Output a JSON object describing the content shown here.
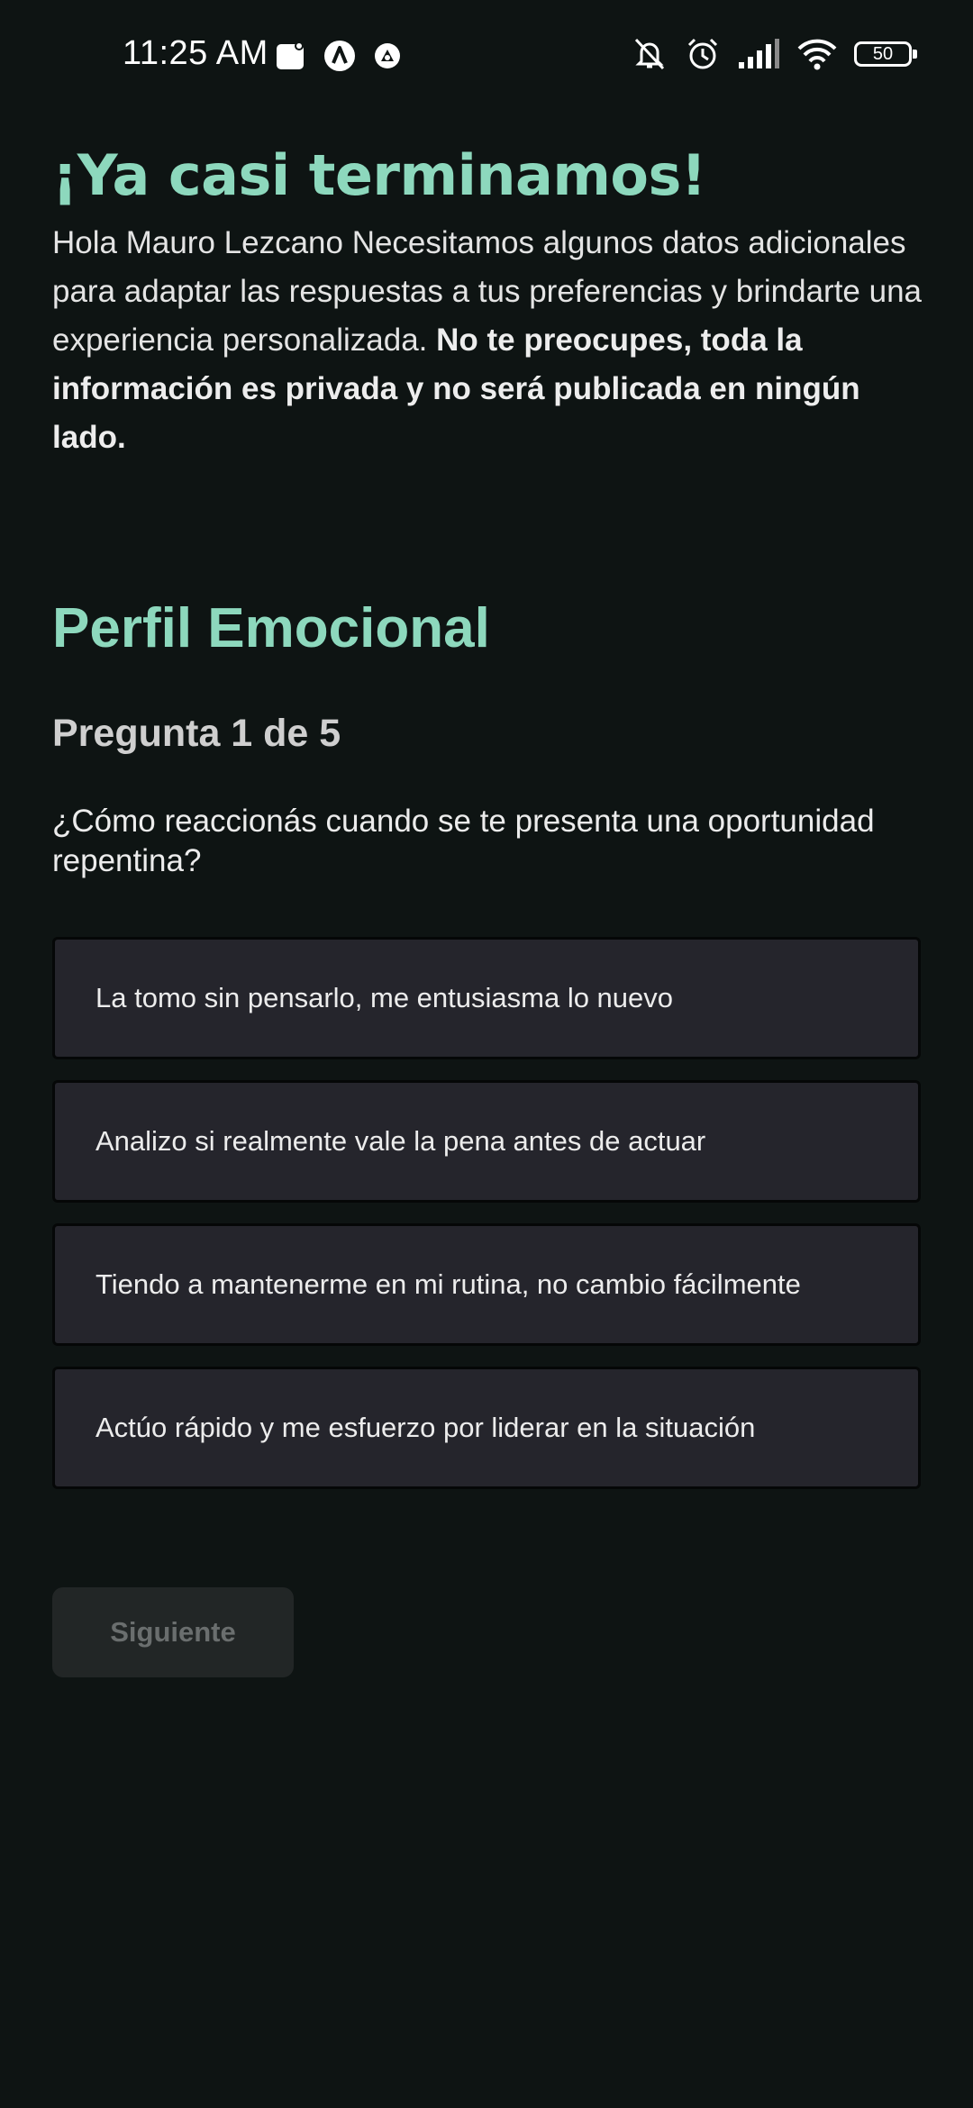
{
  "status_bar": {
    "time": "11:25 AM",
    "battery_level": "50",
    "left_icons": [
      "notification-square-icon",
      "app-a-icon",
      "app-notification-icon"
    ],
    "right_icons": [
      "mute-icon",
      "alarm-icon",
      "signal-icon",
      "wifi-icon",
      "battery-icon"
    ]
  },
  "header": {
    "title": "¡Ya casi terminamos!",
    "intro_text": "Hola Mauro Lezcano Necesitamos algunos datos adicionales para adaptar las respuestas a tus preferencias y brindarte una experiencia personalizada. ",
    "intro_bold": "No te preocupes, toda la información es privada y no será publicada en ningún lado."
  },
  "section": {
    "title": "Perfil Emocional",
    "counter": "Pregunta 1 de 5",
    "question": "¿Cómo reaccionás cuando se te presenta una oportunidad repentina?"
  },
  "options": [
    {
      "label": "La tomo sin pensarlo, me entusiasma lo nuevo"
    },
    {
      "label": "Analizo si realmente vale la pena antes de actuar"
    },
    {
      "label": "Tiendo a mantenerme en mi rutina, no cambio fácilmente"
    },
    {
      "label": "Actúo rápido y me esfuerzo por liderar en la situación"
    }
  ],
  "actions": {
    "next_label": "Siguiente",
    "next_enabled": false
  },
  "colors": {
    "background": "#0e1413",
    "accent": "#8dd8bd",
    "option_background": "#25252c",
    "disabled_button": "#222626"
  }
}
